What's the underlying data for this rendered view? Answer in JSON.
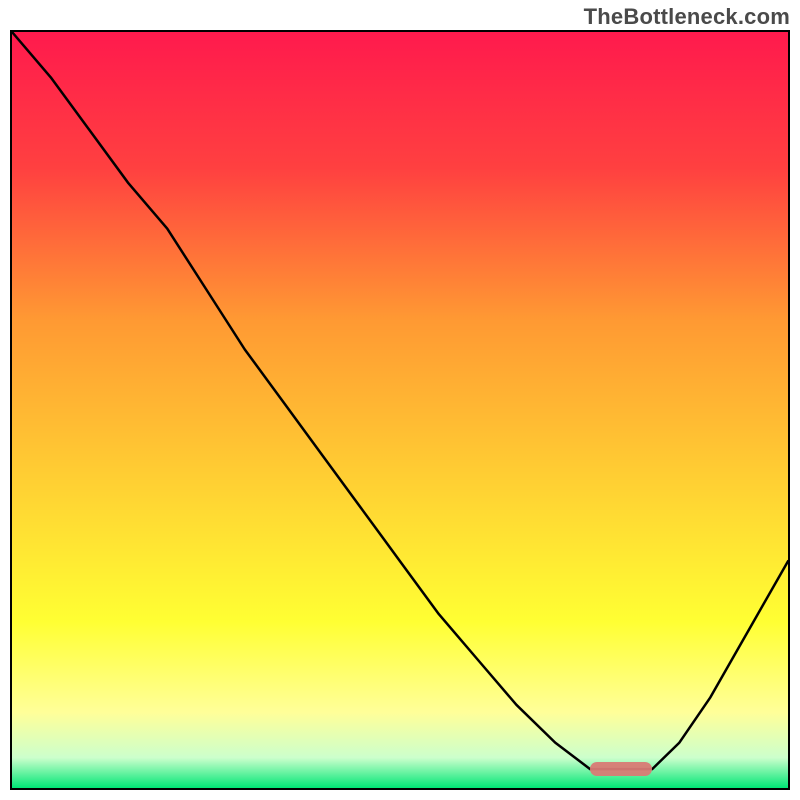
{
  "watermark": "TheBottleneck.com",
  "plot": {
    "inner_width": 776,
    "inner_height": 756
  },
  "gradient_stops": [
    {
      "offset": "0%",
      "color": "#ff1a4d"
    },
    {
      "offset": "18%",
      "color": "#ff4040"
    },
    {
      "offset": "38%",
      "color": "#ff9933"
    },
    {
      "offset": "58%",
      "color": "#ffcc33"
    },
    {
      "offset": "78%",
      "color": "#ffff33"
    },
    {
      "offset": "90%",
      "color": "#ffff99"
    },
    {
      "offset": "96%",
      "color": "#ccffcc"
    },
    {
      "offset": "100%",
      "color": "#00e676"
    }
  ],
  "marker": {
    "x_start_frac": 0.745,
    "x_end_frac": 0.825,
    "y_frac": 0.975,
    "color": "#d97a75"
  },
  "chart_data": {
    "type": "line",
    "title": "",
    "xlabel": "",
    "ylabel": "",
    "xlim": [
      0,
      1
    ],
    "ylim": [
      0,
      1
    ],
    "annotations": [
      "TheBottleneck.com"
    ],
    "series": [
      {
        "name": "bottleneck_curve",
        "x": [
          0.0,
          0.05,
          0.1,
          0.15,
          0.2,
          0.25,
          0.3,
          0.35,
          0.4,
          0.45,
          0.5,
          0.55,
          0.6,
          0.65,
          0.7,
          0.745,
          0.785,
          0.825,
          0.86,
          0.9,
          0.95,
          1.0
        ],
        "y": [
          1.0,
          0.94,
          0.87,
          0.8,
          0.74,
          0.66,
          0.58,
          0.51,
          0.44,
          0.37,
          0.3,
          0.23,
          0.17,
          0.11,
          0.06,
          0.025,
          0.025,
          0.025,
          0.06,
          0.12,
          0.21,
          0.3
        ]
      }
    ],
    "optimal_range": {
      "x_start": 0.745,
      "x_end": 0.825,
      "y": 0.025
    }
  }
}
